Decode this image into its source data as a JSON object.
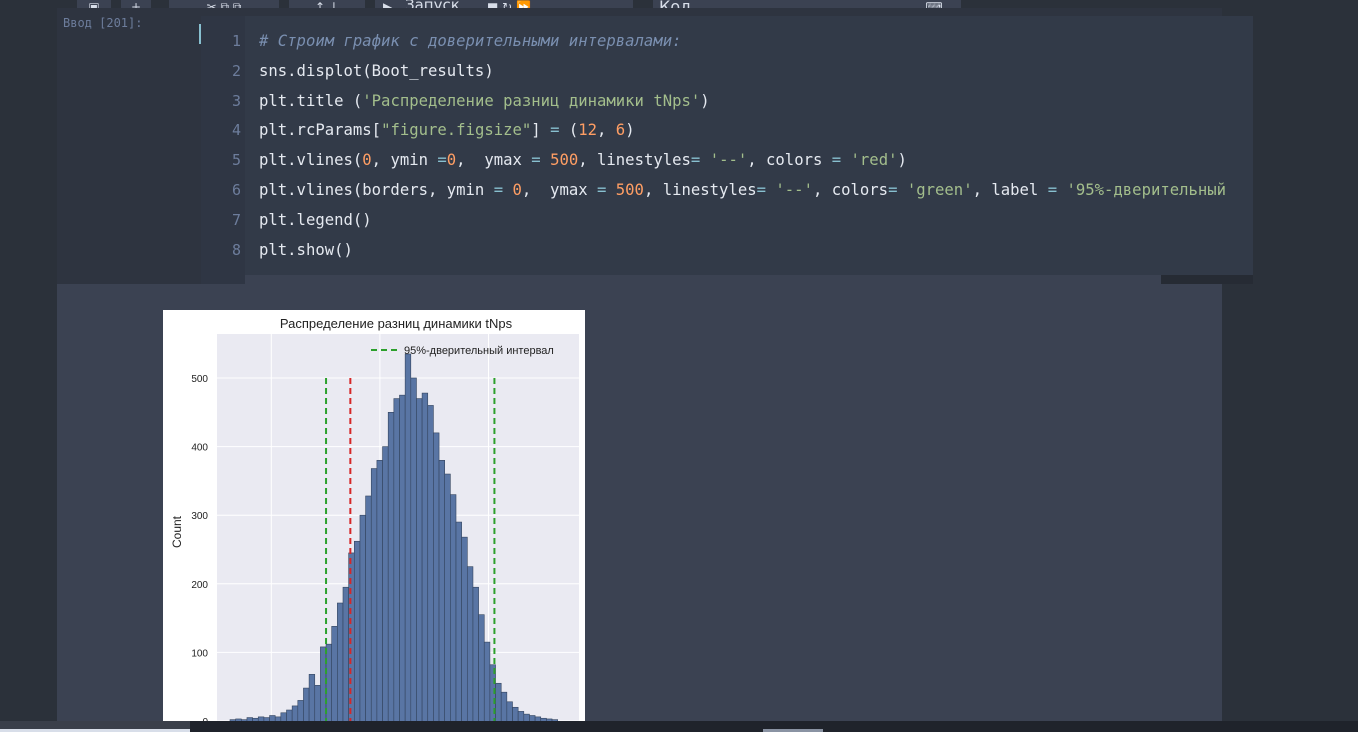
{
  "toolbar": {
    "run_label": "Запуск",
    "cell_type": "Код"
  },
  "cell": {
    "prompt": "Ввод [201]:",
    "line_numbers": [
      "1",
      "2",
      "3",
      "4",
      "5",
      "6",
      "7",
      "8"
    ],
    "code_lines": [
      "# Строим график с доверительными интервалами:",
      "sns.displot(Boot_results)",
      "plt.title ('Распределение разниц динамики tNps')",
      "plt.rcParams[\"figure.figsize\"] = (12, 6)",
      "plt.vlines(0, ymin =0,  ymax = 500, linestyles= '--', colors = 'red')",
      "plt.vlines(borders, ymin = 0,  ymax = 500, linestyles= '--', colors= 'green', label = '95%-дверительный",
      "plt.legend()",
      "plt.show()"
    ]
  },
  "chart_data": {
    "type": "bar",
    "title": "Распределение разниц динамики tNps",
    "xlabel": "",
    "ylabel": "Count",
    "yticks": [
      "0",
      "100",
      "200",
      "300",
      "400",
      "500"
    ],
    "ylim": [
      0,
      560
    ],
    "legend": {
      "label": "95%-дверительный интервал",
      "placement": "top-right"
    },
    "counts": [
      2,
      3,
      2,
      5,
      4,
      6,
      5,
      8,
      6,
      12,
      16,
      22,
      30,
      48,
      68,
      52,
      108,
      112,
      138,
      172,
      195,
      245,
      262,
      300,
      328,
      368,
      380,
      400,
      450,
      470,
      475,
      535,
      500,
      470,
      478,
      460,
      420,
      380,
      360,
      330,
      290,
      268,
      225,
      195,
      155,
      115,
      82,
      55,
      42,
      28,
      20,
      14,
      10,
      8,
      6,
      4,
      3,
      2
    ],
    "vlines": [
      {
        "bin": 17.0,
        "value": 500,
        "color": "#2ca02c"
      },
      {
        "bin": 21.3,
        "value": 500,
        "color": "#d62728"
      },
      {
        "bin": 46.8,
        "value": 500,
        "color": "#2ca02c"
      }
    ],
    "colors": {
      "bar": "#5975a4",
      "bar_edge": "#33445e",
      "plot_bg": "#eaeaf2",
      "grid": "#ffffff"
    }
  }
}
